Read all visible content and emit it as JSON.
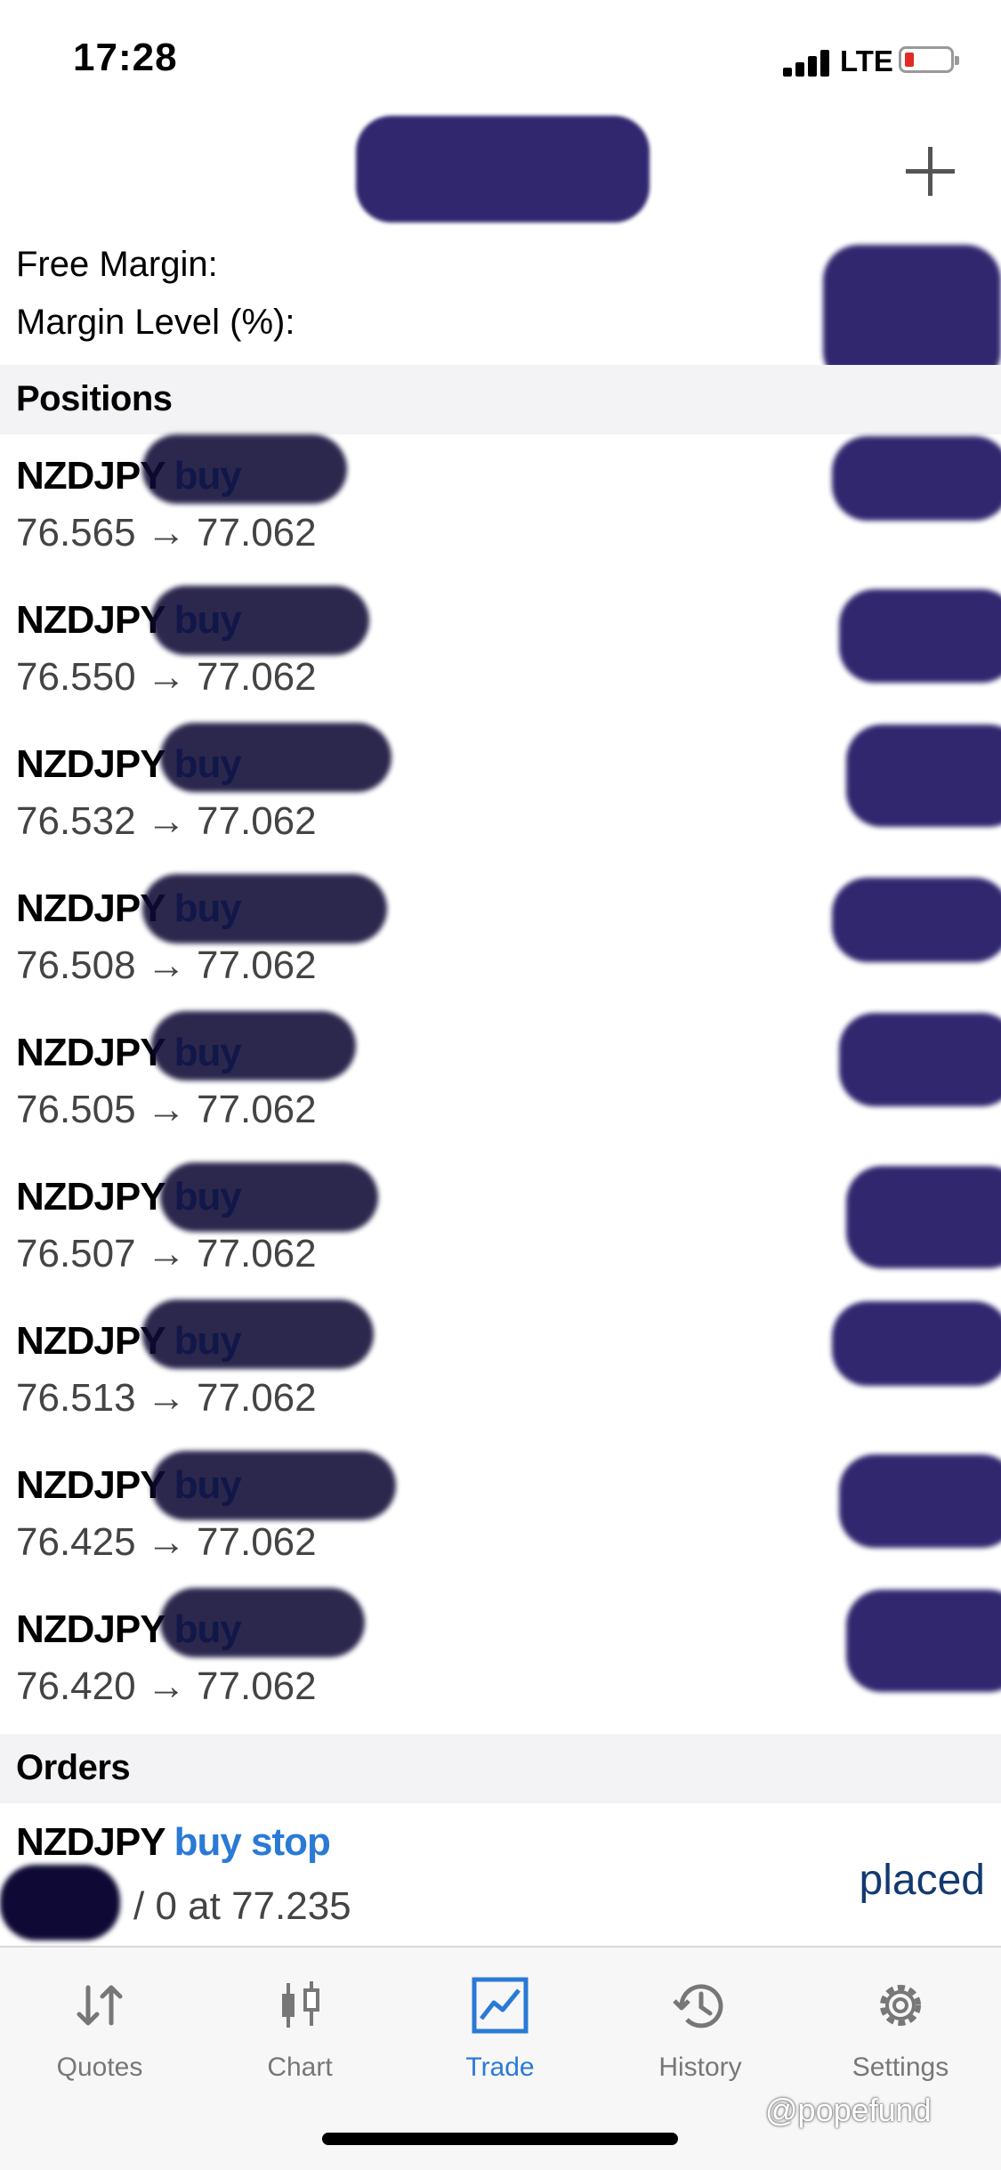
{
  "status_bar": {
    "time": "17:28",
    "network": "LTE",
    "battery_level": 0.1
  },
  "summary": {
    "free_margin_label": "Free Margin:",
    "margin_level_label": "Margin Level (%):"
  },
  "positions": {
    "header": "Positions",
    "items": [
      {
        "symbol": "NZDJPY",
        "side": "buy",
        "open": "76.565",
        "arrow": "→",
        "current": "77.062"
      },
      {
        "symbol": "NZDJPY",
        "side": "buy",
        "open": "76.550",
        "arrow": "→",
        "current": "77.062"
      },
      {
        "symbol": "NZDJPY",
        "side": "buy",
        "open": "76.532",
        "arrow": "→",
        "current": "77.062"
      },
      {
        "symbol": "NZDJPY",
        "side": "buy",
        "open": "76.508",
        "arrow": "→",
        "current": "77.062"
      },
      {
        "symbol": "NZDJPY",
        "side": "buy",
        "open": "76.505",
        "arrow": "→",
        "current": "77.062"
      },
      {
        "symbol": "NZDJPY",
        "side": "buy",
        "open": "76.507",
        "arrow": "→",
        "current": "77.062"
      },
      {
        "symbol": "NZDJPY",
        "side": "buy",
        "open": "76.513",
        "arrow": "→",
        "current": "77.062"
      },
      {
        "symbol": "NZDJPY",
        "side": "buy",
        "open": "76.425",
        "arrow": "→",
        "current": "77.062"
      },
      {
        "symbol": "NZDJPY",
        "side": "buy",
        "open": "76.420",
        "arrow": "→",
        "current": "77.062"
      }
    ]
  },
  "orders": {
    "header": "Orders",
    "items": [
      {
        "symbol": "NZDJPY",
        "side": "buy stop",
        "detail": "/ 0 at 77.235",
        "status": "placed"
      }
    ]
  },
  "tab_bar": {
    "tabs": [
      {
        "label": "Quotes",
        "icon": "quotes-icon",
        "active": false
      },
      {
        "label": "Chart",
        "icon": "chart-icon",
        "active": false
      },
      {
        "label": "Trade",
        "icon": "trade-icon",
        "active": true
      },
      {
        "label": "History",
        "icon": "history-icon",
        "active": false
      },
      {
        "label": "Settings",
        "icon": "gear-icon",
        "active": false
      }
    ]
  },
  "watermark": "@popefund",
  "colors": {
    "accent": "#2a7ad5",
    "redaction": "#1f1563",
    "status_placed": "#123a6e"
  }
}
